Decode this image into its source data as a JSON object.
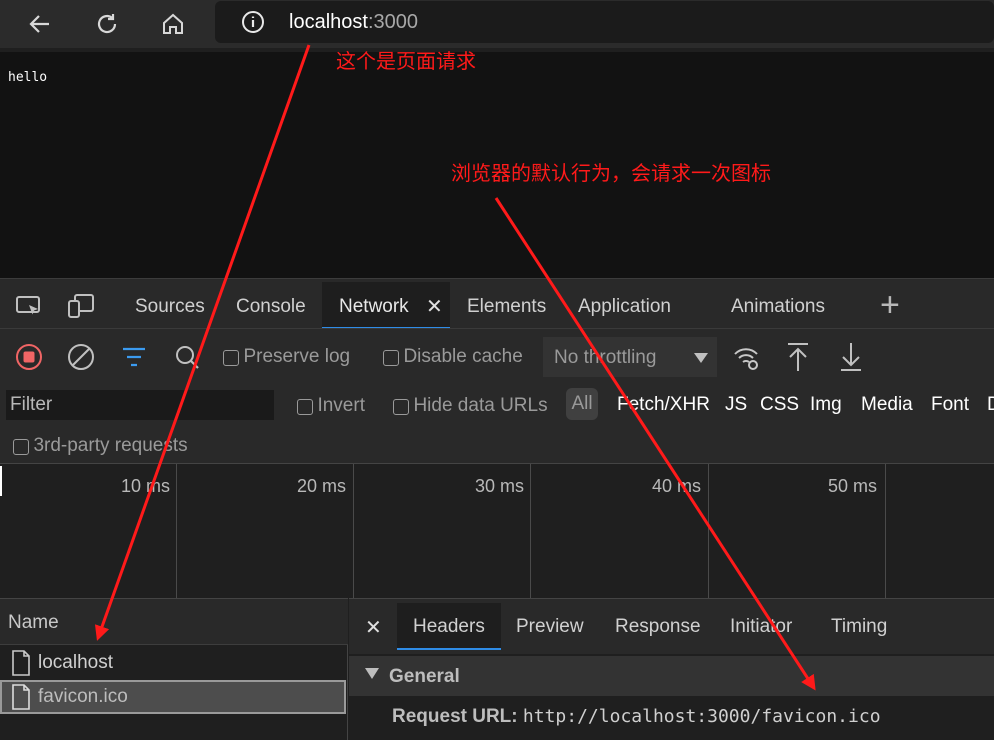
{
  "browser": {
    "url_host": "localhost",
    "url_port": ":3000"
  },
  "page": {
    "body_text": "hello"
  },
  "annotations": {
    "page_request": "这个是页面请求",
    "favicon_note": "浏览器的默认行为，会请求一次图标",
    "color": "#ff1a1a"
  },
  "devtools": {
    "tabs": [
      {
        "label": "Sources"
      },
      {
        "label": "Console"
      },
      {
        "label": "Network",
        "active": true
      },
      {
        "label": "Elements"
      },
      {
        "label": "Application"
      },
      {
        "label": "Animations"
      }
    ],
    "toolbar": {
      "preserve_log": "Preserve log",
      "disable_cache": "Disable cache",
      "throttling": "No throttling"
    },
    "filter": {
      "placeholder": "Filter",
      "invert": "Invert",
      "hide_data_urls": "Hide data URLs",
      "all": "All",
      "types": [
        "Fetch/XHR",
        "JS",
        "CSS",
        "Img",
        "Media",
        "Font",
        "D"
      ]
    },
    "third_party": "3rd-party requests",
    "timeline_ticks": [
      "10 ms",
      "20 ms",
      "30 ms",
      "40 ms",
      "50 ms"
    ],
    "requests": {
      "header": "Name",
      "rows": [
        {
          "name": "localhost"
        },
        {
          "name": "favicon.ico",
          "selected": true
        }
      ]
    },
    "details": {
      "tabs": [
        {
          "label": "Headers",
          "active": true
        },
        {
          "label": "Preview"
        },
        {
          "label": "Response"
        },
        {
          "label": "Initiator"
        },
        {
          "label": "Timing"
        }
      ],
      "section": "General",
      "request_url_label": "Request URL:",
      "request_url_value": "http://localhost:3000/favicon.ico"
    }
  },
  "accent_color": "#2f8ce6",
  "record_color": "#f06565"
}
